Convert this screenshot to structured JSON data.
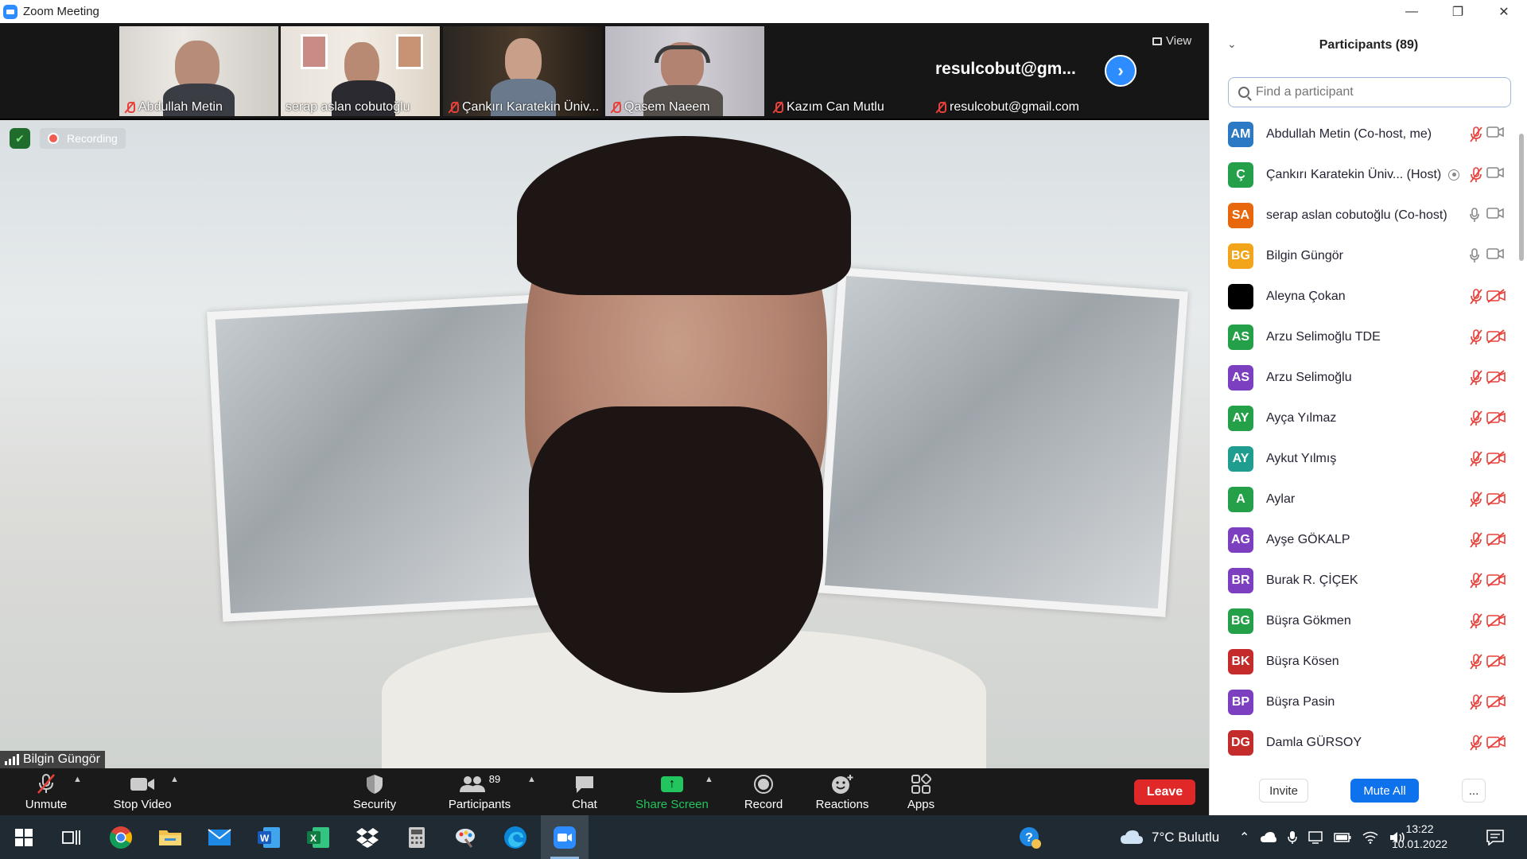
{
  "window": {
    "title": "Zoom Meeting",
    "controls": [
      "minimize",
      "maximize",
      "close"
    ]
  },
  "thumbnails": [
    {
      "name": "Abdullah Metin",
      "muted": true
    },
    {
      "name": "serap aslan cobutoğlu",
      "muted": false
    },
    {
      "name": "Çankırı Karatekin Üniv...",
      "muted": true
    },
    {
      "name": "Qasem Naeem",
      "muted": true
    },
    {
      "name": "Kazım Can Mutlu",
      "muted": true
    },
    {
      "name": "resulcobut@gmail.com",
      "muted": true
    }
  ],
  "big_name": "resulcobut@gm...",
  "view_label": "View",
  "recording_label": "Recording",
  "active_speaker": "Bilgin Güngör",
  "toolbar": {
    "unmute": "Unmute",
    "stop_video": "Stop Video",
    "security": "Security",
    "participants": "Participants",
    "participants_count": "89",
    "chat": "Chat",
    "share_screen": "Share Screen",
    "record": "Record",
    "reactions": "Reactions",
    "apps": "Apps",
    "leave": "Leave"
  },
  "panel": {
    "title": "Participants (89)",
    "search_placeholder": "Find a participant",
    "invite": "Invite",
    "mute_all": "Mute All",
    "more": "..."
  },
  "participants": [
    {
      "initials": "AM",
      "name": "Abdullah Metin (Co-host, me)",
      "color": "#2b78c5",
      "mic": "off",
      "cam": "on"
    },
    {
      "initials": "Ç",
      "name": "Çankırı Karatekin Üniv...  (Host)",
      "color": "#24a148",
      "mic": "off",
      "cam": "on",
      "recording": true
    },
    {
      "initials": "SA",
      "name": "serap aslan cobutoğlu (Co-host)",
      "color": "#e8670c",
      "mic": "on",
      "cam": "on"
    },
    {
      "initials": "BG",
      "name": "Bilgin Güngör",
      "color": "#f2a51a",
      "mic": "on",
      "cam": "on"
    },
    {
      "initials": "",
      "name": "Aleyna Çokan",
      "color": "#000000",
      "mic": "off",
      "cam": "off"
    },
    {
      "initials": "AS",
      "name": "Arzu  Selimoğlu TDE",
      "color": "#24a148",
      "mic": "off",
      "cam": "off"
    },
    {
      "initials": "AS",
      "name": "Arzu Selimoğlu",
      "color": "#7b3fbf",
      "mic": "off",
      "cam": "off"
    },
    {
      "initials": "AY",
      "name": "Ayça Yılmaz",
      "color": "#24a148",
      "mic": "off",
      "cam": "off"
    },
    {
      "initials": "AY",
      "name": "Aykut Yılmış",
      "color": "#1f9e8f",
      "mic": "off",
      "cam": "off"
    },
    {
      "initials": "A",
      "name": "Aylar",
      "color": "#24a148",
      "mic": "off",
      "cam": "off"
    },
    {
      "initials": "AG",
      "name": "Ayşe  GÖKALP",
      "color": "#7b3fbf",
      "mic": "off",
      "cam": "off"
    },
    {
      "initials": "BR",
      "name": "Burak R. ÇİÇEK",
      "color": "#7b3fbf",
      "mic": "off",
      "cam": "off"
    },
    {
      "initials": "BG",
      "name": "Büşra Gökmen",
      "color": "#24a148",
      "mic": "off",
      "cam": "off"
    },
    {
      "initials": "BK",
      "name": "Büşra Kösen",
      "color": "#c42b2b",
      "mic": "off",
      "cam": "off"
    },
    {
      "initials": "BP",
      "name": "Büşra Pasin",
      "color": "#7b3fbf",
      "mic": "off",
      "cam": "off"
    },
    {
      "initials": "DG",
      "name": "Damla GÜRSOY",
      "color": "#c42b2b",
      "mic": "off",
      "cam": "off"
    }
  ],
  "taskbar": {
    "weather": "7°C  Bulutlu",
    "time": "13:22",
    "date": "10.01.2022"
  },
  "colors": {
    "accent": "#2d8cff",
    "leave": "#e02828",
    "share": "#22c55e",
    "muted": "#e8403a"
  }
}
